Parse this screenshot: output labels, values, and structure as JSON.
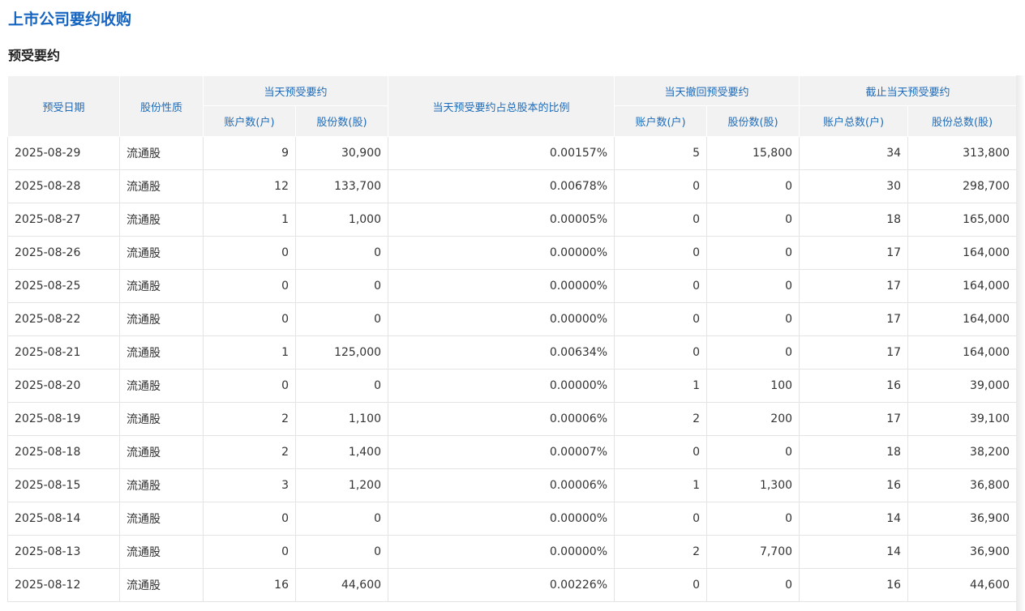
{
  "page": {
    "title": "上市公司要约收购",
    "section_title": "预受要约"
  },
  "table": {
    "headers": {
      "date": "预受日期",
      "share_type": "股份性质",
      "day_accept_group": "当天预受要约",
      "day_accept_accounts": "账户数(户)",
      "day_accept_shares": "股份数(股)",
      "ratio": "当天预受要约占总股本的比例",
      "withdraw_group": "当天撤回预受要约",
      "withdraw_accounts": "账户数(户)",
      "withdraw_shares": "股份数(股)",
      "cumulative_group": "截止当天预受要约",
      "cumulative_accounts": "账户总数(户)",
      "cumulative_shares": "股份总数(股)"
    },
    "rows": [
      [
        "2025-08-29",
        "流通股",
        "9",
        "30,900",
        "0.00157%",
        "5",
        "15,800",
        "34",
        "313,800"
      ],
      [
        "2025-08-28",
        "流通股",
        "12",
        "133,700",
        "0.00678%",
        "0",
        "0",
        "30",
        "298,700"
      ],
      [
        "2025-08-27",
        "流通股",
        "1",
        "1,000",
        "0.00005%",
        "0",
        "0",
        "18",
        "165,000"
      ],
      [
        "2025-08-26",
        "流通股",
        "0",
        "0",
        "0.00000%",
        "0",
        "0",
        "17",
        "164,000"
      ],
      [
        "2025-08-25",
        "流通股",
        "0",
        "0",
        "0.00000%",
        "0",
        "0",
        "17",
        "164,000"
      ],
      [
        "2025-08-22",
        "流通股",
        "0",
        "0",
        "0.00000%",
        "0",
        "0",
        "17",
        "164,000"
      ],
      [
        "2025-08-21",
        "流通股",
        "1",
        "125,000",
        "0.00634%",
        "0",
        "0",
        "17",
        "164,000"
      ],
      [
        "2025-08-20",
        "流通股",
        "0",
        "0",
        "0.00000%",
        "1",
        "100",
        "16",
        "39,000"
      ],
      [
        "2025-08-19",
        "流通股",
        "2",
        "1,100",
        "0.00006%",
        "2",
        "200",
        "17",
        "39,100"
      ],
      [
        "2025-08-18",
        "流通股",
        "2",
        "1,400",
        "0.00007%",
        "0",
        "0",
        "18",
        "38,200"
      ],
      [
        "2025-08-15",
        "流通股",
        "3",
        "1,200",
        "0.00006%",
        "1",
        "1,300",
        "16",
        "36,800"
      ],
      [
        "2025-08-14",
        "流通股",
        "0",
        "0",
        "0.00000%",
        "0",
        "0",
        "14",
        "36,900"
      ],
      [
        "2025-08-13",
        "流通股",
        "0",
        "0",
        "0.00000%",
        "2",
        "7,700",
        "14",
        "36,900"
      ],
      [
        "2025-08-12",
        "流通股",
        "16",
        "44,600",
        "0.00226%",
        "0",
        "0",
        "16",
        "44,600"
      ]
    ]
  }
}
